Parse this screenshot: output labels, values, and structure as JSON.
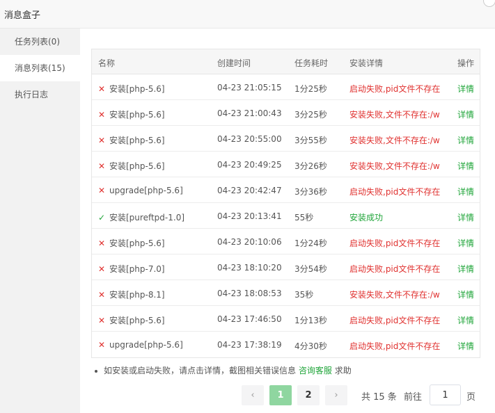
{
  "window": {
    "title": "消息盒子"
  },
  "sidebar": {
    "items": [
      {
        "label": "任务列表(0)",
        "active": false
      },
      {
        "label": "消息列表(15)",
        "active": true
      },
      {
        "label": "执行日志",
        "active": false
      }
    ]
  },
  "table": {
    "headers": {
      "name": "名称",
      "created": "创建时间",
      "duration": "任务耗时",
      "detail": "安装详情",
      "action": "操作"
    },
    "rows": [
      {
        "status": "fail",
        "name": "安装[php-5.6]",
        "created": "04-23 21:05:15",
        "duration": "1分25秒",
        "detail": "启动失败,pid文件不存在",
        "action": "详情"
      },
      {
        "status": "fail",
        "name": "安装[php-5.6]",
        "created": "04-23 21:00:43",
        "duration": "3分25秒",
        "detail": "安装失败,文件不存在:/w",
        "action": "详情"
      },
      {
        "status": "fail",
        "name": "安装[php-5.6]",
        "created": "04-23 20:55:00",
        "duration": "3分55秒",
        "detail": "安装失败,文件不存在:/w",
        "action": "详情"
      },
      {
        "status": "fail",
        "name": "安装[php-5.6]",
        "created": "04-23 20:49:25",
        "duration": "3分26秒",
        "detail": "安装失败,文件不存在:/w",
        "action": "详情"
      },
      {
        "status": "fail",
        "name": "upgrade[php-5.6]",
        "created": "04-23 20:42:47",
        "duration": "3分36秒",
        "detail": "启动失败,pid文件不存在",
        "action": "详情"
      },
      {
        "status": "ok",
        "name": "安装[pureftpd-1.0]",
        "created": "04-23 20:13:41",
        "duration": "55秒",
        "detail": "安装成功",
        "action": "详情"
      },
      {
        "status": "fail",
        "name": "安装[php-5.6]",
        "created": "04-23 20:10:06",
        "duration": "1分24秒",
        "detail": "启动失败,pid文件不存在",
        "action": "详情"
      },
      {
        "status": "fail",
        "name": "安装[php-7.0]",
        "created": "04-23 18:10:20",
        "duration": "3分54秒",
        "detail": "启动失败,pid文件不存在",
        "action": "详情"
      },
      {
        "status": "fail",
        "name": "安装[php-8.1]",
        "created": "04-23 18:08:53",
        "duration": "35秒",
        "detail": "安装失败,文件不存在:/w",
        "action": "详情"
      },
      {
        "status": "fail",
        "name": "安装[php-5.6]",
        "created": "04-23 17:46:50",
        "duration": "1分13秒",
        "detail": "启动失败,pid文件不存在",
        "action": "详情"
      },
      {
        "status": "fail",
        "name": "upgrade[php-5.6]",
        "created": "04-23 17:38:19",
        "duration": "4分30秒",
        "detail": "启动失败,pid文件不存在",
        "action": "详情"
      }
    ]
  },
  "note": {
    "text": "如安装或启动失败，请点击详情，截图相关错误信息",
    "link": "咨询客服",
    "suffix": "求助"
  },
  "pagination": {
    "prev_icon": "chevron-left-icon",
    "next_icon": "chevron-right-icon",
    "pages": [
      "1",
      "2"
    ],
    "current": "1",
    "total_text": "共 15 条",
    "goto_label": "前往",
    "goto_value": "1",
    "page_unit": "页"
  },
  "colors": {
    "fail": "#e0312f",
    "success": "#20a53a",
    "active_page": "#8fd6a0"
  }
}
